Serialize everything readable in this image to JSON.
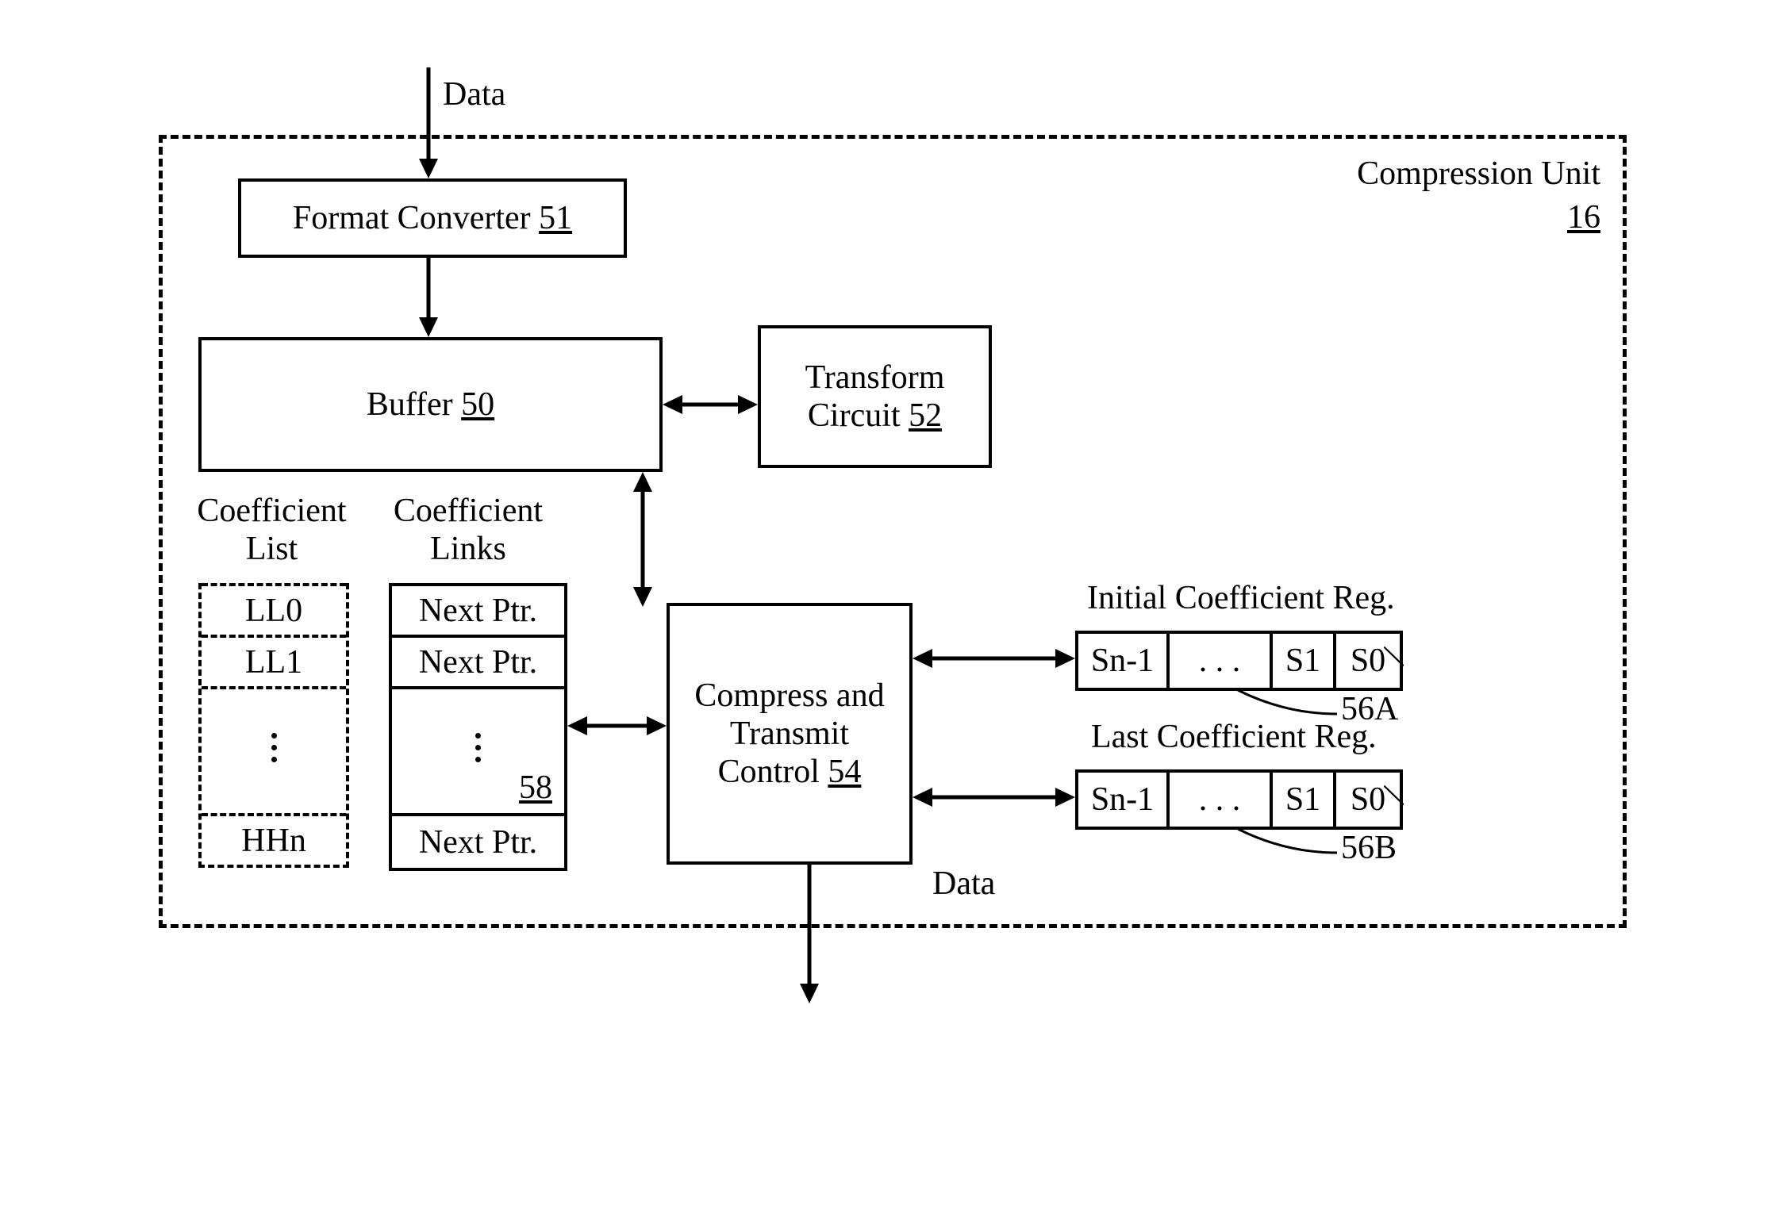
{
  "labels": {
    "data_in": "Data",
    "data_out": "Data",
    "compression_unit": "Compression Unit",
    "compression_unit_ref": "16",
    "format_converter": "Format Converter",
    "format_converter_ref": "51",
    "buffer": "Buffer",
    "buffer_ref": "50",
    "transform_circuit_l1": "Transform",
    "transform_circuit_l2": "Circuit",
    "transform_circuit_ref": "52",
    "compress_transmit_l1": "Compress and",
    "compress_transmit_l2": "Transmit",
    "compress_transmit_l3": "Control",
    "compress_transmit_ref": "54",
    "coef_list_header_l1": "Coefficient",
    "coef_list_header_l2": "List",
    "coef_list_r1": "LL0",
    "coef_list_r2": "LL1",
    "coef_list_r4": "HHn",
    "coef_links_header_l1": "Coefficient",
    "coef_links_header_l2": "Links",
    "coef_links_r1": "Next Ptr.",
    "coef_links_r2": "Next Ptr.",
    "coef_links_r4": "Next Ptr.",
    "coef_links_ref": "58",
    "initial_reg_title": "Initial Coefficient Reg.",
    "last_reg_title": "Last Coefficient Reg.",
    "reg_a_ref": "56A",
    "reg_b_ref": "56B",
    "reg_c0": "Sn-1",
    "reg_c1": ". . .",
    "reg_c2": "S1",
    "reg_c3": "S0"
  }
}
